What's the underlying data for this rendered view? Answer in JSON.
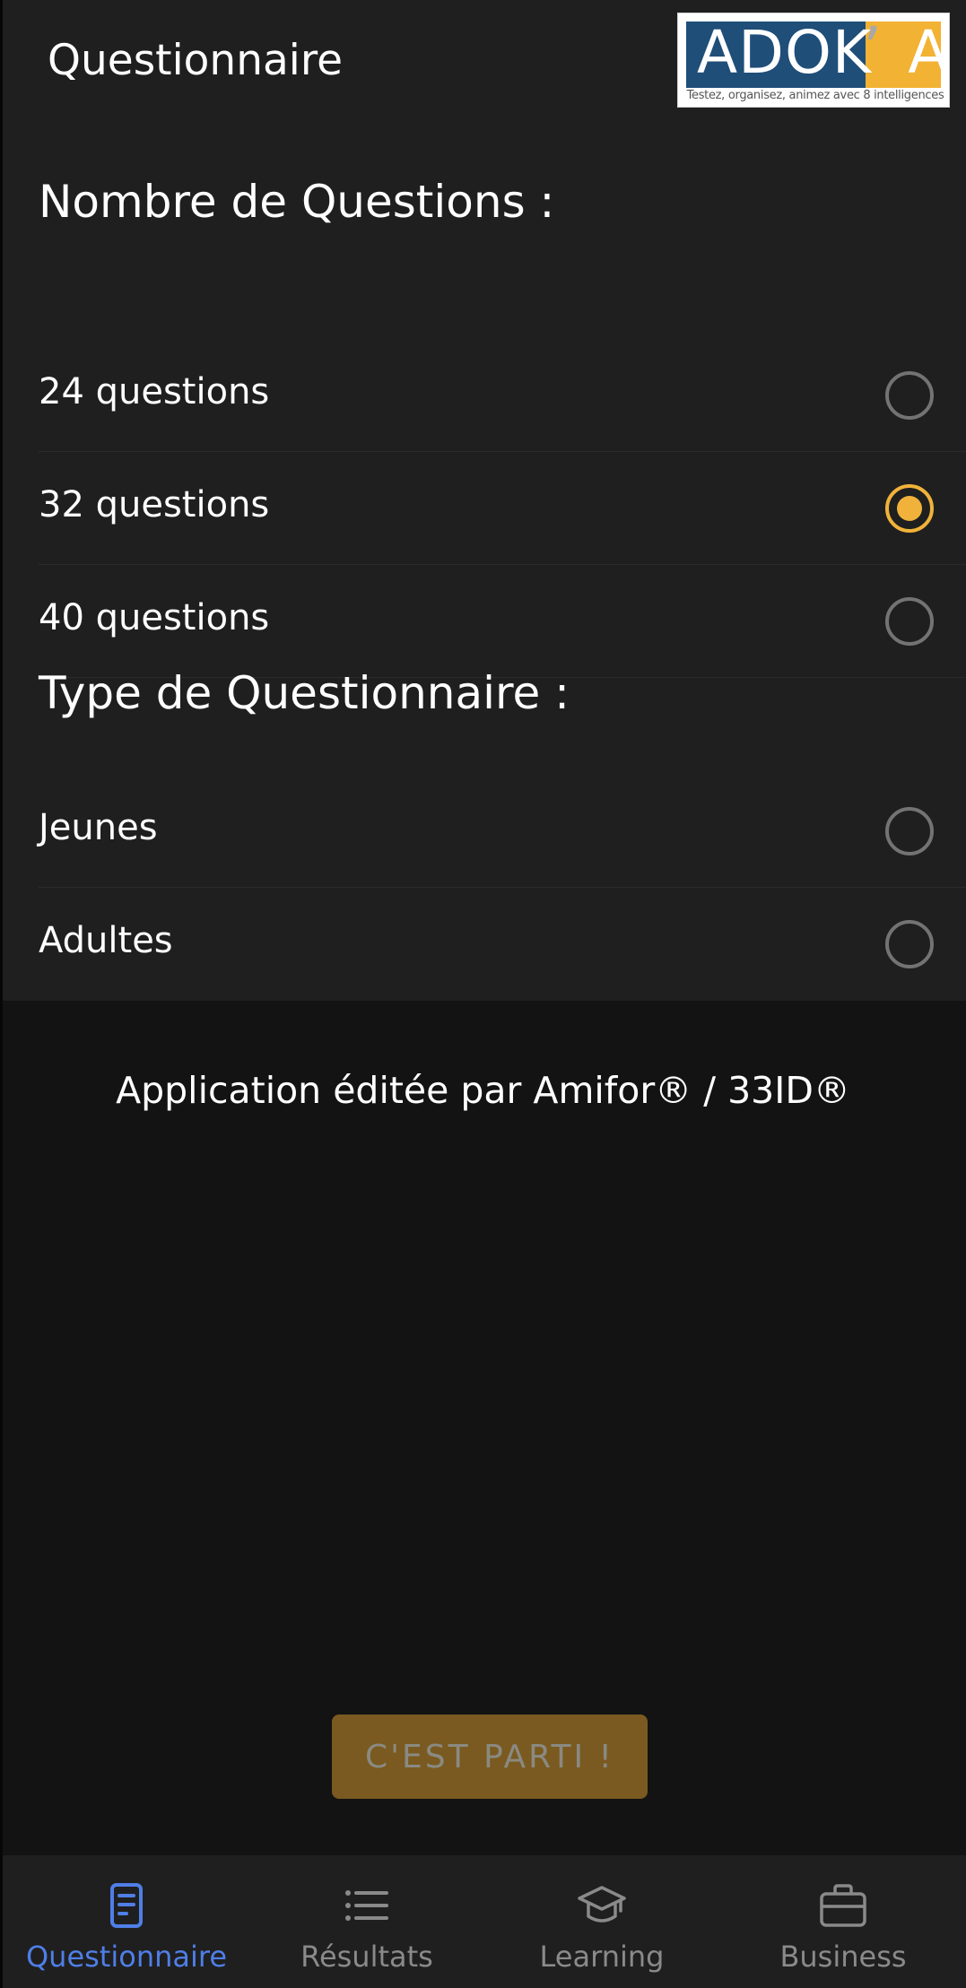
{
  "header": {
    "title": "Questionnaire",
    "logo": {
      "brand": "ADOK",
      "brand_end": "A",
      "apostrophe": "’",
      "tagline": "Testez, organisez, animez avec 8 intelligences"
    }
  },
  "question_count": {
    "title": "Nombre de Questions :",
    "options": [
      {
        "label": "24 questions",
        "selected": false
      },
      {
        "label": "32 questions",
        "selected": true
      },
      {
        "label": "40 questions",
        "selected": false
      }
    ]
  },
  "questionnaire_type": {
    "title": "Type de Questionnaire :",
    "options": [
      {
        "label": "Jeunes",
        "selected": false
      },
      {
        "label": "Adultes",
        "selected": false
      }
    ]
  },
  "credit": "Application éditée par Amifor® / 33ID®",
  "start_button": {
    "label": "C'EST PARTI !",
    "enabled": false
  },
  "bottom_nav": {
    "items": [
      {
        "label": "Questionnaire",
        "icon": "document-icon",
        "active": true
      },
      {
        "label": "Résultats",
        "icon": "list-icon",
        "active": false
      },
      {
        "label": "Learning",
        "icon": "graduation-cap-icon",
        "active": false
      },
      {
        "label": "Business",
        "icon": "briefcase-icon",
        "active": false
      }
    ]
  },
  "colors": {
    "accent": "#f0b23a",
    "active_nav": "#4f7ee6",
    "panel": "#1f1f1f",
    "background": "#131313"
  }
}
